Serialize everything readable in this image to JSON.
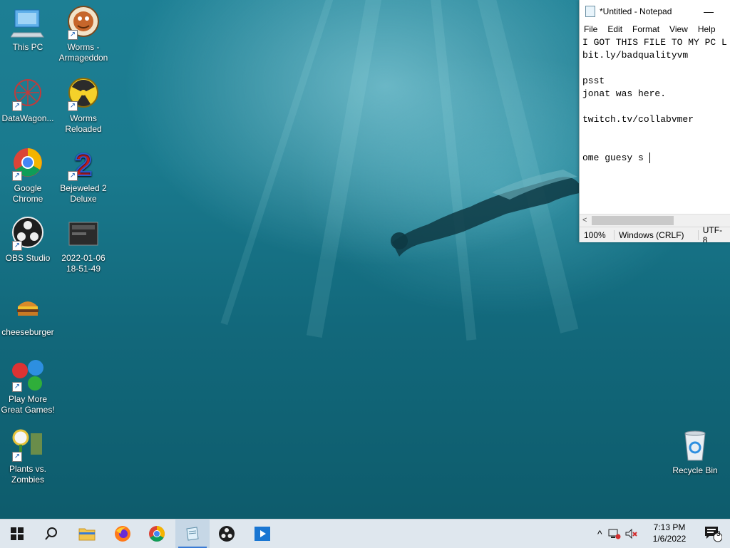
{
  "desktop": {
    "icons": [
      {
        "label": "This PC",
        "name": "this-pc-icon"
      },
      {
        "label": "Worms - Armageddon",
        "name": "worms-armageddon-icon"
      },
      {
        "label": "DataWagon...",
        "name": "datawagon-icon"
      },
      {
        "label": "Worms Reloaded",
        "name": "worms-reloaded-icon"
      },
      {
        "label": "Google Chrome",
        "name": "google-chrome-icon"
      },
      {
        "label": "Bejeweled 2 Deluxe",
        "name": "bejeweled-2-deluxe-icon"
      },
      {
        "label": "OBS Studio",
        "name": "obs-studio-icon"
      },
      {
        "label": "2022-01-06 18-51-49",
        "name": "video-file-icon"
      },
      {
        "label": "cheeseburger",
        "name": "cheeseburger-icon"
      },
      {
        "label": "Play More Great Games!",
        "name": "play-more-games-icon"
      },
      {
        "label": "Plants vs. Zombies",
        "name": "plants-vs-zombies-icon"
      },
      {
        "label": "Recycle Bin",
        "name": "recycle-bin-icon"
      }
    ]
  },
  "notepad": {
    "title": "*Untitled - Notepad",
    "minimize_glyph": "—",
    "menu": [
      "File",
      "Edit",
      "Format",
      "View",
      "Help"
    ],
    "lines": [
      "I GOT THIS FILE TO MY PC L",
      "bit.ly/badqualityvm",
      "",
      "psst",
      "jonat was here.",
      "",
      "twitch.tv/collabvmer",
      "",
      "",
      "ome guesy s "
    ],
    "status": {
      "zoom": "100%",
      "line_ending": "Windows (CRLF)",
      "encoding": "UTF-8"
    },
    "scroll_left_glyph": "<"
  },
  "taskbar": {
    "time": "7:13 PM",
    "date": "1/6/2022",
    "notification_count": "3",
    "tray_chevron": "^",
    "pinned": [
      "windows-start",
      "search",
      "file-explorer",
      "firefox",
      "chrome",
      "notepad",
      "obs-studio",
      "media-player"
    ]
  }
}
